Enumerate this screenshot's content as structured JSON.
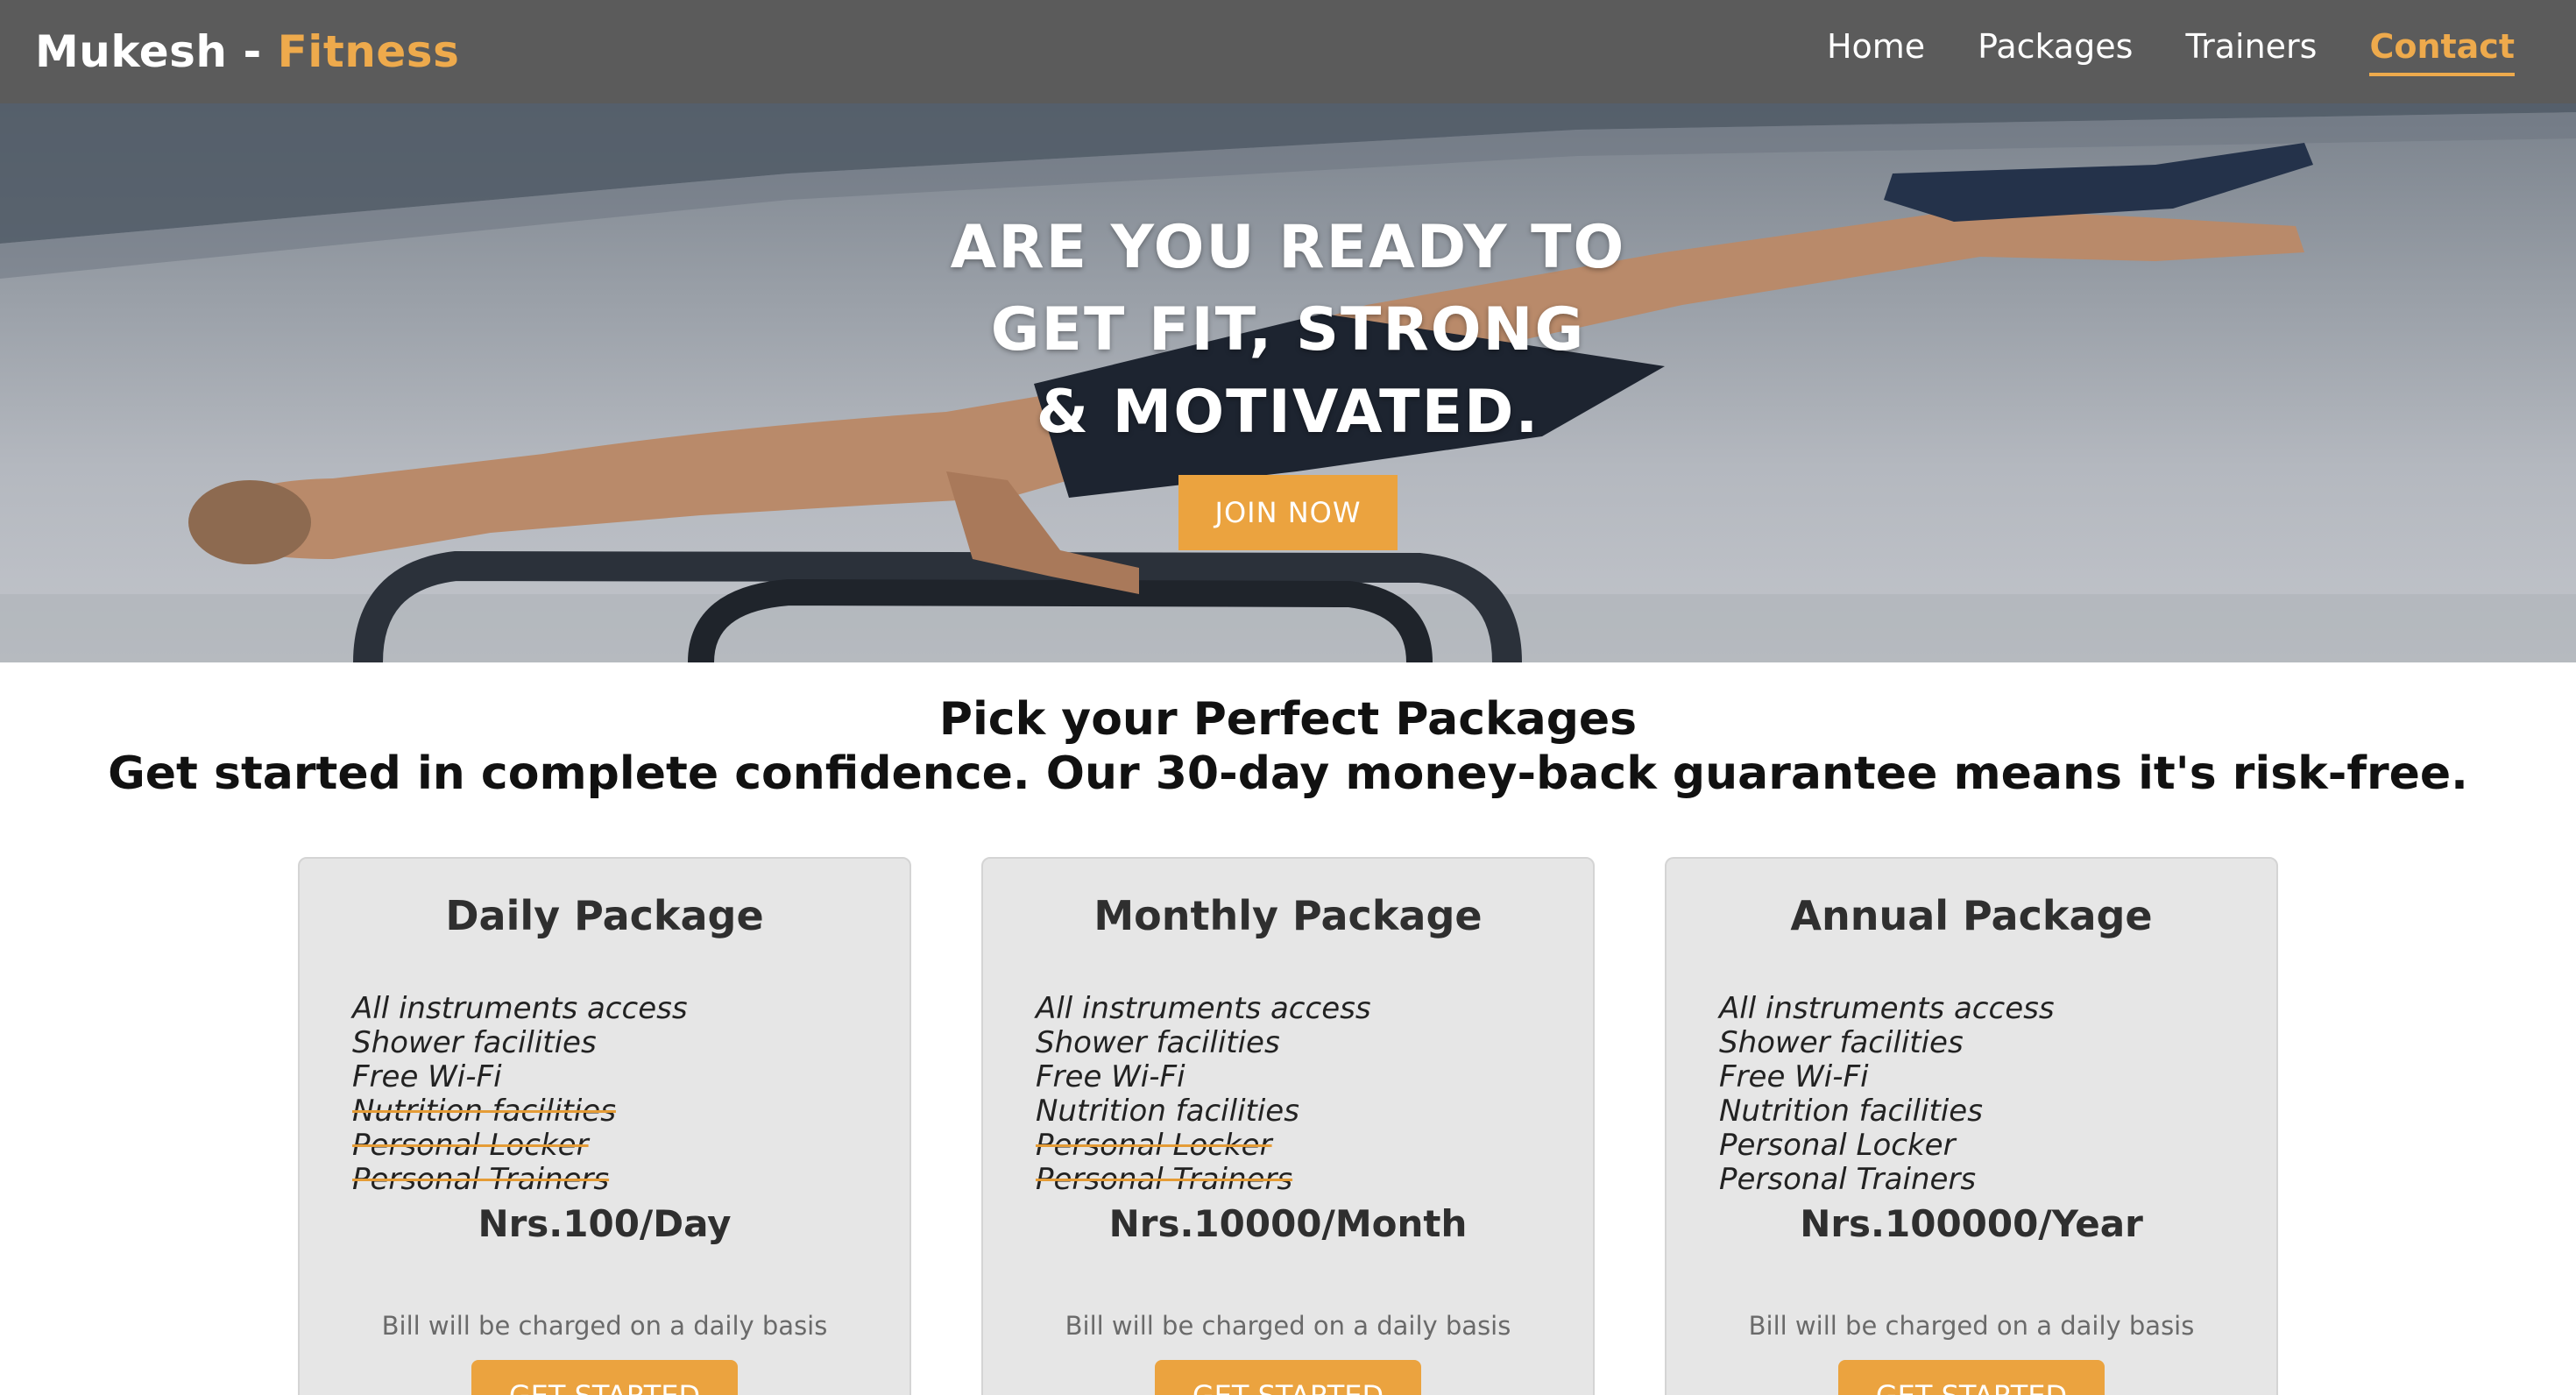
{
  "navbar": {
    "brand_name": "Mukesh",
    "brand_separator": " - ",
    "brand_accent": "Fitness",
    "links": [
      {
        "label": "Home",
        "active": false
      },
      {
        "label": "Packages",
        "active": false
      },
      {
        "label": "Trainers",
        "active": false
      },
      {
        "label": "Contact",
        "active": true
      }
    ]
  },
  "hero": {
    "lines": [
      "ARE YOU READY TO",
      "GET FIT, STRONG",
      "& MOTIVATED."
    ],
    "button_label": "JOIN NOW"
  },
  "packages_section": {
    "title": "Pick your Perfect Packages",
    "subtitle": "Get started in complete confidence. Our 30-day money-back guarantee means it's risk-free.",
    "cards": [
      {
        "title": "Daily Package",
        "features": [
          {
            "label": "All instruments access",
            "included": true
          },
          {
            "label": "Shower facilities",
            "included": true
          },
          {
            "label": "Free Wi-Fi",
            "included": true
          },
          {
            "label": "Nutrition facilities",
            "included": false
          },
          {
            "label": "Personal Locker",
            "included": false
          },
          {
            "label": "Personal Trainers",
            "included": false
          }
        ],
        "price": "Nrs.100/Day",
        "billing": "Bill will be charged on a daily basis",
        "button_label": "GET STARTED"
      },
      {
        "title": "Monthly Package",
        "features": [
          {
            "label": "All instruments access",
            "included": true
          },
          {
            "label": "Shower facilities",
            "included": true
          },
          {
            "label": "Free Wi-Fi",
            "included": true
          },
          {
            "label": "Nutrition facilities",
            "included": true
          },
          {
            "label": "Personal Locker",
            "included": false
          },
          {
            "label": "Personal Trainers",
            "included": false
          }
        ],
        "price": "Nrs.10000/Month",
        "billing": "Bill will be charged on a daily basis",
        "button_label": "GET STARTED"
      },
      {
        "title": "Annual Package",
        "features": [
          {
            "label": "All instruments access",
            "included": true
          },
          {
            "label": "Shower facilities",
            "included": true
          },
          {
            "label": "Free Wi-Fi",
            "included": true
          },
          {
            "label": "Nutrition facilities",
            "included": true
          },
          {
            "label": "Personal Locker",
            "included": true
          },
          {
            "label": "Personal Trainers",
            "included": true
          }
        ],
        "price": "Nrs.100000/Year",
        "billing": "Bill will be charged on a daily basis",
        "button_label": "GET STARTED"
      }
    ]
  },
  "colors": {
    "navbar_bg": "#5b5b5b",
    "accent": "#eba33f",
    "card_bg": "#e6e6e6"
  }
}
